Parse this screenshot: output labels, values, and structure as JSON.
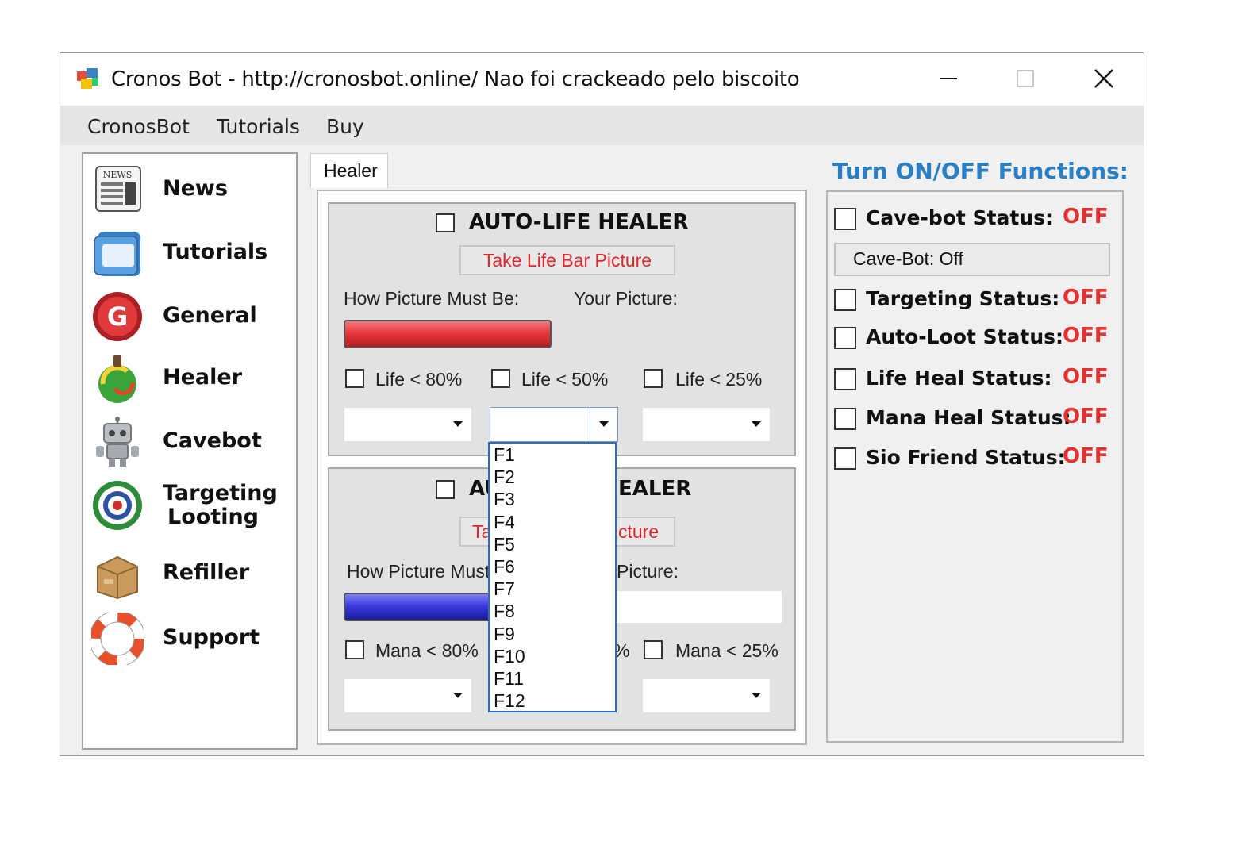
{
  "window": {
    "title": "Cronos Bot - http://cronosbot.online/ Nao foi crackeado pelo biscoito"
  },
  "menu": [
    "CronosBot",
    "Tutorials",
    "Buy"
  ],
  "sidebar": {
    "items": [
      {
        "label": "News",
        "icon": "news-icon"
      },
      {
        "label": "Tutorials",
        "icon": "tutorials-icon"
      },
      {
        "label": "General",
        "icon": "general-icon"
      },
      {
        "label": "Healer",
        "icon": "healer-icon"
      },
      {
        "label": "Cavebot",
        "icon": "cavebot-icon"
      },
      {
        "label": "Targeting",
        "label2": "Looting",
        "icon": "targeting-icon"
      },
      {
        "label": "Refiller",
        "icon": "refiller-icon"
      },
      {
        "label": "Support",
        "icon": "support-icon"
      }
    ]
  },
  "tab": {
    "label": "Healer"
  },
  "life_healer": {
    "title": "AUTO-LIFE HEALER",
    "button": "Take Life Bar Picture",
    "how_label": "How Picture Must Be:",
    "your_label": "Your Picture:",
    "checks": [
      "Life < 80%",
      "Life < 50%",
      "Life < 25%"
    ],
    "bar_color": "#e8383d"
  },
  "mana_healer": {
    "title_left": "AU",
    "title_right": "EALER",
    "button_left": "Ta",
    "button_right": "cture",
    "how_label": "How Picture Must",
    "your_label": "Picture:",
    "checks": [
      "Mana < 80%",
      "%",
      "Mana < 25%"
    ],
    "bar_color": "#3c3ce0"
  },
  "dropdown": {
    "options": [
      "F1",
      "F2",
      "F3",
      "F4",
      "F5",
      "F6",
      "F7",
      "F8",
      "F9",
      "F10",
      "F11",
      "F12"
    ]
  },
  "functions": {
    "title": "Turn ON/OFF Functions:",
    "cave_box": "Cave-Bot: Off",
    "rows": [
      {
        "label": "Cave-bot Status:",
        "value": "OFF"
      },
      {
        "label": "Targeting Status:",
        "value": "OFF"
      },
      {
        "label": "Auto-Loot Status:",
        "value": "OFF"
      },
      {
        "label": "Life Heal Status:",
        "value": "OFF"
      },
      {
        "label": "Mana Heal Status:",
        "value": "OFF"
      },
      {
        "label": "Sio Friend Status:",
        "value": "OFF"
      }
    ],
    "off_color": "#e43030"
  }
}
